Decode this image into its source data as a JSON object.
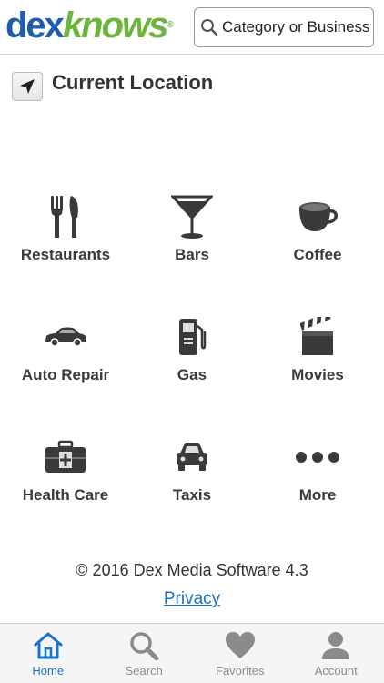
{
  "header": {
    "logo_dex": "dex",
    "logo_knows": "knows",
    "logo_tm": "®",
    "search_placeholder": "Category or Business"
  },
  "location": {
    "label": "Current Location"
  },
  "categories": [
    {
      "label": "Restaurants",
      "icon": "fork-knife-icon"
    },
    {
      "label": "Bars",
      "icon": "martini-icon"
    },
    {
      "label": "Coffee",
      "icon": "coffee-cup-icon"
    },
    {
      "label": "Auto Repair",
      "icon": "car-icon"
    },
    {
      "label": "Gas",
      "icon": "gas-pump-icon"
    },
    {
      "label": "Movies",
      "icon": "clapperboard-icon"
    },
    {
      "label": "Health Care",
      "icon": "medical-kit-icon"
    },
    {
      "label": "Taxis",
      "icon": "taxi-icon"
    },
    {
      "label": "More",
      "icon": "more-dots-icon"
    }
  ],
  "footer": {
    "copyright": "© 2016 Dex Media Software 4.3",
    "privacy": "Privacy"
  },
  "tabs": [
    {
      "label": "Home",
      "icon": "home-icon",
      "active": true
    },
    {
      "label": "Search",
      "icon": "search-icon",
      "active": false
    },
    {
      "label": "Favorites",
      "icon": "heart-icon",
      "active": false
    },
    {
      "label": "Account",
      "icon": "account-icon",
      "active": false
    }
  ],
  "colors": {
    "brand_blue": "#1f5ea8",
    "brand_green": "#6db33f",
    "link_blue": "#1a73c8",
    "icon_gray": "#3a3a3a"
  }
}
